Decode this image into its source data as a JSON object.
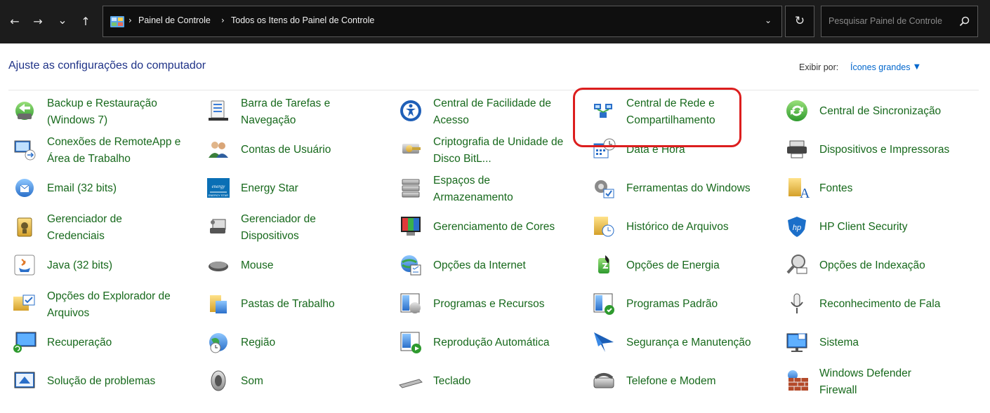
{
  "nav": {
    "back_icon": "←",
    "forward_icon": "→",
    "recent_icon": "⌄",
    "up_icon": "↑",
    "breadcrumbs": [
      "Painel de Controle",
      "Todos os Itens do Painel de Controle"
    ],
    "refresh_icon": "↻",
    "search_placeholder": "Pesquisar Painel de Controle"
  },
  "header": {
    "title": "Ajuste as configurações do computador",
    "view_by_label": "Exibir por:",
    "view_by_value": "Ícones grandes"
  },
  "items": [
    {
      "label": [
        "Backup e Restauração",
        "(Windows 7)"
      ],
      "icon": "backup-icon"
    },
    {
      "label": [
        "Barra de Tarefas e",
        "Navegação"
      ],
      "icon": "taskbar-icon"
    },
    {
      "label": [
        "Central de Facilidade de",
        "Acesso"
      ],
      "icon": "ease-of-access-icon"
    },
    {
      "label": [
        "Central de Rede e",
        "Compartilhamento"
      ],
      "icon": "network-icon"
    },
    {
      "label": [
        "Central de Sincronização"
      ],
      "icon": "sync-icon"
    },
    {
      "label": [
        "Conexões de RemoteApp e",
        "Área de Trabalho"
      ],
      "icon": "remoteapp-icon"
    },
    {
      "label": [
        "Contas de Usuário"
      ],
      "icon": "user-accounts-icon"
    },
    {
      "label": [
        "Criptografia de Unidade de",
        "Disco BitL..."
      ],
      "icon": "bitlocker-icon"
    },
    {
      "label": [
        "Data e Hora"
      ],
      "icon": "date-time-icon"
    },
    {
      "label": [
        "Dispositivos e Impressoras"
      ],
      "icon": "devices-printers-icon"
    },
    {
      "label": [
        "Email (32 bits)"
      ],
      "icon": "email-icon"
    },
    {
      "label": [
        "Energy Star"
      ],
      "icon": "energy-star-icon"
    },
    {
      "label": [
        "Espaços de",
        "Armazenamento"
      ],
      "icon": "storage-spaces-icon"
    },
    {
      "label": [
        "Ferramentas do Windows"
      ],
      "icon": "windows-tools-icon"
    },
    {
      "label": [
        "Fontes"
      ],
      "icon": "fonts-icon"
    },
    {
      "label": [
        "Gerenciador de",
        "Credenciais"
      ],
      "icon": "credential-manager-icon"
    },
    {
      "label": [
        "Gerenciador de",
        "Dispositivos"
      ],
      "icon": "device-manager-icon"
    },
    {
      "label": [
        "Gerenciamento de Cores"
      ],
      "icon": "color-management-icon"
    },
    {
      "label": [
        "Histórico de Arquivos"
      ],
      "icon": "file-history-icon"
    },
    {
      "label": [
        "HP Client Security"
      ],
      "icon": "hp-security-icon"
    },
    {
      "label": [
        "Java (32 bits)"
      ],
      "icon": "java-icon"
    },
    {
      "label": [
        "Mouse"
      ],
      "icon": "mouse-icon"
    },
    {
      "label": [
        "Opções da Internet"
      ],
      "icon": "internet-options-icon"
    },
    {
      "label": [
        "Opções de Energia"
      ],
      "icon": "power-options-icon"
    },
    {
      "label": [
        "Opções de Indexação"
      ],
      "icon": "indexing-icon"
    },
    {
      "label": [
        "Opções do Explorador de",
        "Arquivos"
      ],
      "icon": "explorer-options-icon"
    },
    {
      "label": [
        "Pastas de Trabalho"
      ],
      "icon": "work-folders-icon"
    },
    {
      "label": [
        "Programas e Recursos"
      ],
      "icon": "programs-features-icon"
    },
    {
      "label": [
        "Programas Padrão"
      ],
      "icon": "default-programs-icon"
    },
    {
      "label": [
        "Reconhecimento de Fala"
      ],
      "icon": "speech-recognition-icon"
    },
    {
      "label": [
        "Recuperação"
      ],
      "icon": "recovery-icon"
    },
    {
      "label": [
        "Região"
      ],
      "icon": "region-icon"
    },
    {
      "label": [
        "Reprodução Automática"
      ],
      "icon": "autoplay-icon"
    },
    {
      "label": [
        "Segurança e Manutenção"
      ],
      "icon": "security-maintenance-icon"
    },
    {
      "label": [
        "Sistema"
      ],
      "icon": "system-icon"
    },
    {
      "label": [
        "Solução de problemas"
      ],
      "icon": "troubleshooting-icon"
    },
    {
      "label": [
        "Som"
      ],
      "icon": "sound-icon"
    },
    {
      "label": [
        "Teclado"
      ],
      "icon": "keyboard-icon"
    },
    {
      "label": [
        "Telefone e Modem"
      ],
      "icon": "phone-modem-icon"
    },
    {
      "label": [
        "Windows Defender",
        "Firewall"
      ],
      "icon": "firewall-icon"
    }
  ],
  "colors": {
    "nav_bg": "#1c1c1c",
    "heading": "#1e3287",
    "item_text": "#17691c",
    "link": "#0066cc",
    "highlight": "#dc1e1e"
  }
}
